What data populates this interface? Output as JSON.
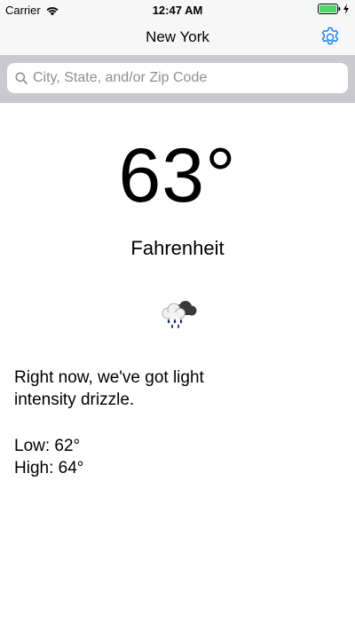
{
  "status_bar": {
    "carrier": "Carrier",
    "time": "12:47 AM",
    "battery_color": "#4cd964"
  },
  "nav": {
    "title": "New York",
    "settings_icon": "gear-icon",
    "accent_color": "#007aff"
  },
  "search": {
    "placeholder": "City, State, and/or Zip Code",
    "value": ""
  },
  "weather": {
    "temperature": "63°",
    "unit": "Fahrenheit",
    "icon": "rain-cloud-icon",
    "description": "Right now, we've got light intensity drizzle.",
    "low": "Low: 62°",
    "high": "High: 64°"
  }
}
